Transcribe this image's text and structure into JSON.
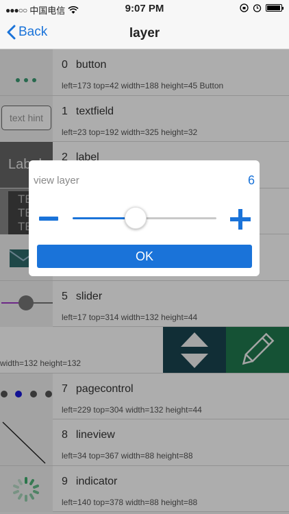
{
  "status_bar": {
    "carrier": "中国电信",
    "time": "9:07 PM"
  },
  "nav": {
    "back_label": "Back",
    "title": "layer"
  },
  "rows": [
    {
      "index": "0",
      "name": "button",
      "frame": "left=173 top=42 width=188 height=45 Button"
    },
    {
      "index": "1",
      "name": "textfield",
      "frame": "left=23 top=192 width=325 height=32",
      "thumb_text": "text hint"
    },
    {
      "index": "2",
      "name": "label",
      "thumb_text": "Label"
    },
    {
      "thumb_text": "TE"
    },
    {},
    {
      "index": "5",
      "name": "slider",
      "frame": "left=17 top=314 width=132 height=44"
    }
  ],
  "swiped_row": {
    "frame": "width=132 height=132"
  },
  "rows_after": [
    {
      "index": "7",
      "name": "pagecontrol",
      "frame": "left=229 top=304 width=132 height=44"
    },
    {
      "index": "8",
      "name": "lineview",
      "frame": "left=34 top=367 width=88 height=88"
    },
    {
      "index": "9",
      "name": "indicator",
      "frame": "left=140 top=378 width=88 height=88"
    }
  ],
  "dialog": {
    "title": "view layer",
    "value": "6",
    "ok_label": "OK",
    "slider_fraction": 0.44
  },
  "colors": {
    "accent": "#1a73d9",
    "move_bg": "#1a4550",
    "edit_bg": "#1f7a4f"
  }
}
